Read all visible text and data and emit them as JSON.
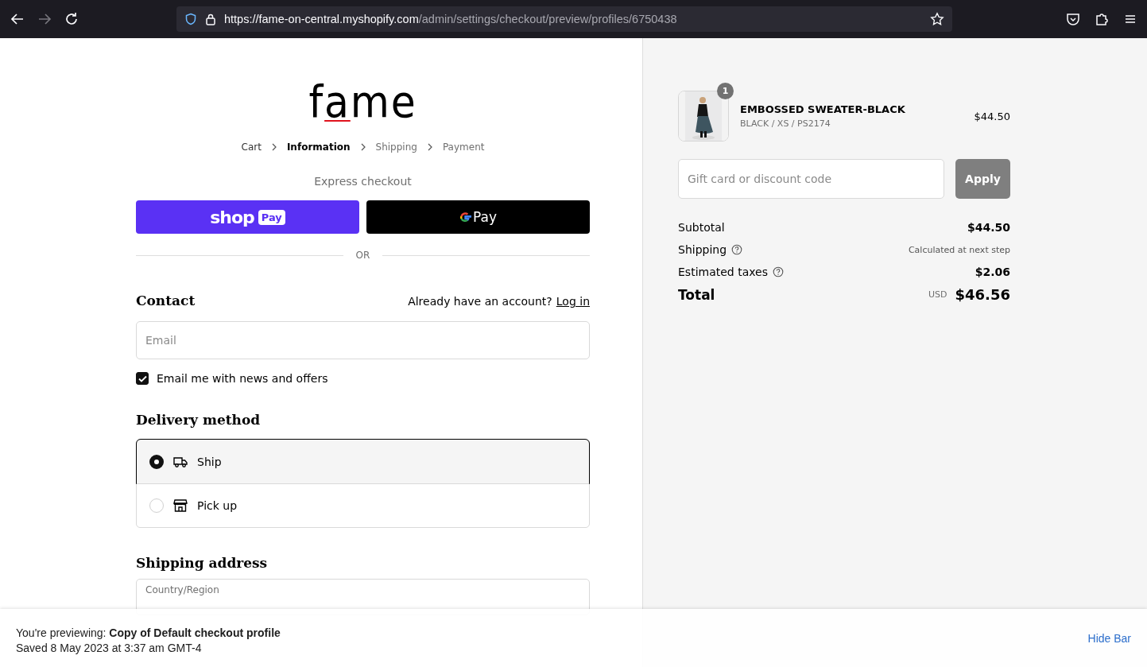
{
  "browser": {
    "url_origin": "https://fame-on-central.myshopify.com",
    "url_path": "/admin/settings/checkout/preview/profiles/6750438"
  },
  "logo": "fame",
  "breadcrumbs": [
    {
      "label": "Cart",
      "selected": false,
      "visited": true
    },
    {
      "label": "Information",
      "selected": true,
      "visited": true
    },
    {
      "label": "Shipping",
      "selected": false,
      "visited": false
    },
    {
      "label": "Payment",
      "selected": false,
      "visited": false
    }
  ],
  "express": {
    "title": "Express checkout",
    "buttons": [
      {
        "kind": "shoppay",
        "label": "shop",
        "badge": "Pay"
      },
      {
        "kind": "gpay",
        "label": "Pay"
      }
    ],
    "divider": "OR"
  },
  "contact": {
    "title": "Contact",
    "account_prompt": "Already have an account?",
    "login": "Log in",
    "email": {
      "placeholder": "Email"
    },
    "newsletter": {
      "label": "Email me with news and offers",
      "checked": true
    }
  },
  "delivery": {
    "title": "Delivery method",
    "options": [
      {
        "label": "Ship",
        "kind": "ship",
        "selected": true
      },
      {
        "label": "Pick up",
        "kind": "pickup",
        "selected": false
      }
    ]
  },
  "shipping_address": {
    "title": "Shipping address",
    "country_label": "Country/Region"
  },
  "summary": {
    "item": {
      "quantity": "1",
      "name": "EMBOSSED SWEATER-BLACK",
      "variant": "BLACK / XS / PS2174",
      "price": "$44.50"
    },
    "discount": {
      "placeholder": "Gift card or discount code",
      "button": "Apply"
    },
    "lines": [
      {
        "label": "Subtotal",
        "value": "$44.50",
        "info": false,
        "kind": "amount"
      },
      {
        "label": "Shipping",
        "value": "Calculated at next step",
        "info": true,
        "kind": "note"
      },
      {
        "label": "Estimated taxes",
        "value": "$2.06",
        "info": true,
        "kind": "amount"
      }
    ],
    "total": {
      "label": "Total",
      "currency": "USD",
      "value": "$46.56"
    }
  },
  "preview_bar": {
    "prefix": "You're previewing:",
    "profile": "Copy of Default checkout profile",
    "saved": "Saved 8 May 2023 at 3:37 am GMT-4",
    "hide": "Hide Bar"
  }
}
